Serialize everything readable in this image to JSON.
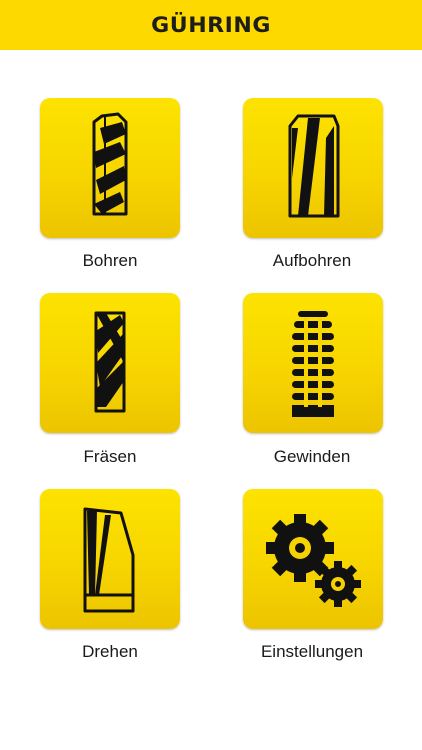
{
  "header": {
    "brand": "GÜHRING",
    "background": "#fed900"
  },
  "menu": {
    "items": [
      {
        "label": "Bohren",
        "icon": "drill-icon"
      },
      {
        "label": "Aufbohren",
        "icon": "reamer-icon"
      },
      {
        "label": "Fräsen",
        "icon": "end-mill-icon"
      },
      {
        "label": "Gewinden",
        "icon": "tap-icon"
      },
      {
        "label": "Drehen",
        "icon": "turning-insert-icon"
      },
      {
        "label": "Einstellungen",
        "icon": "gears-icon"
      }
    ]
  },
  "colors": {
    "accent": "#fed900",
    "icon": "#111111",
    "text": "#1a1a1a"
  }
}
